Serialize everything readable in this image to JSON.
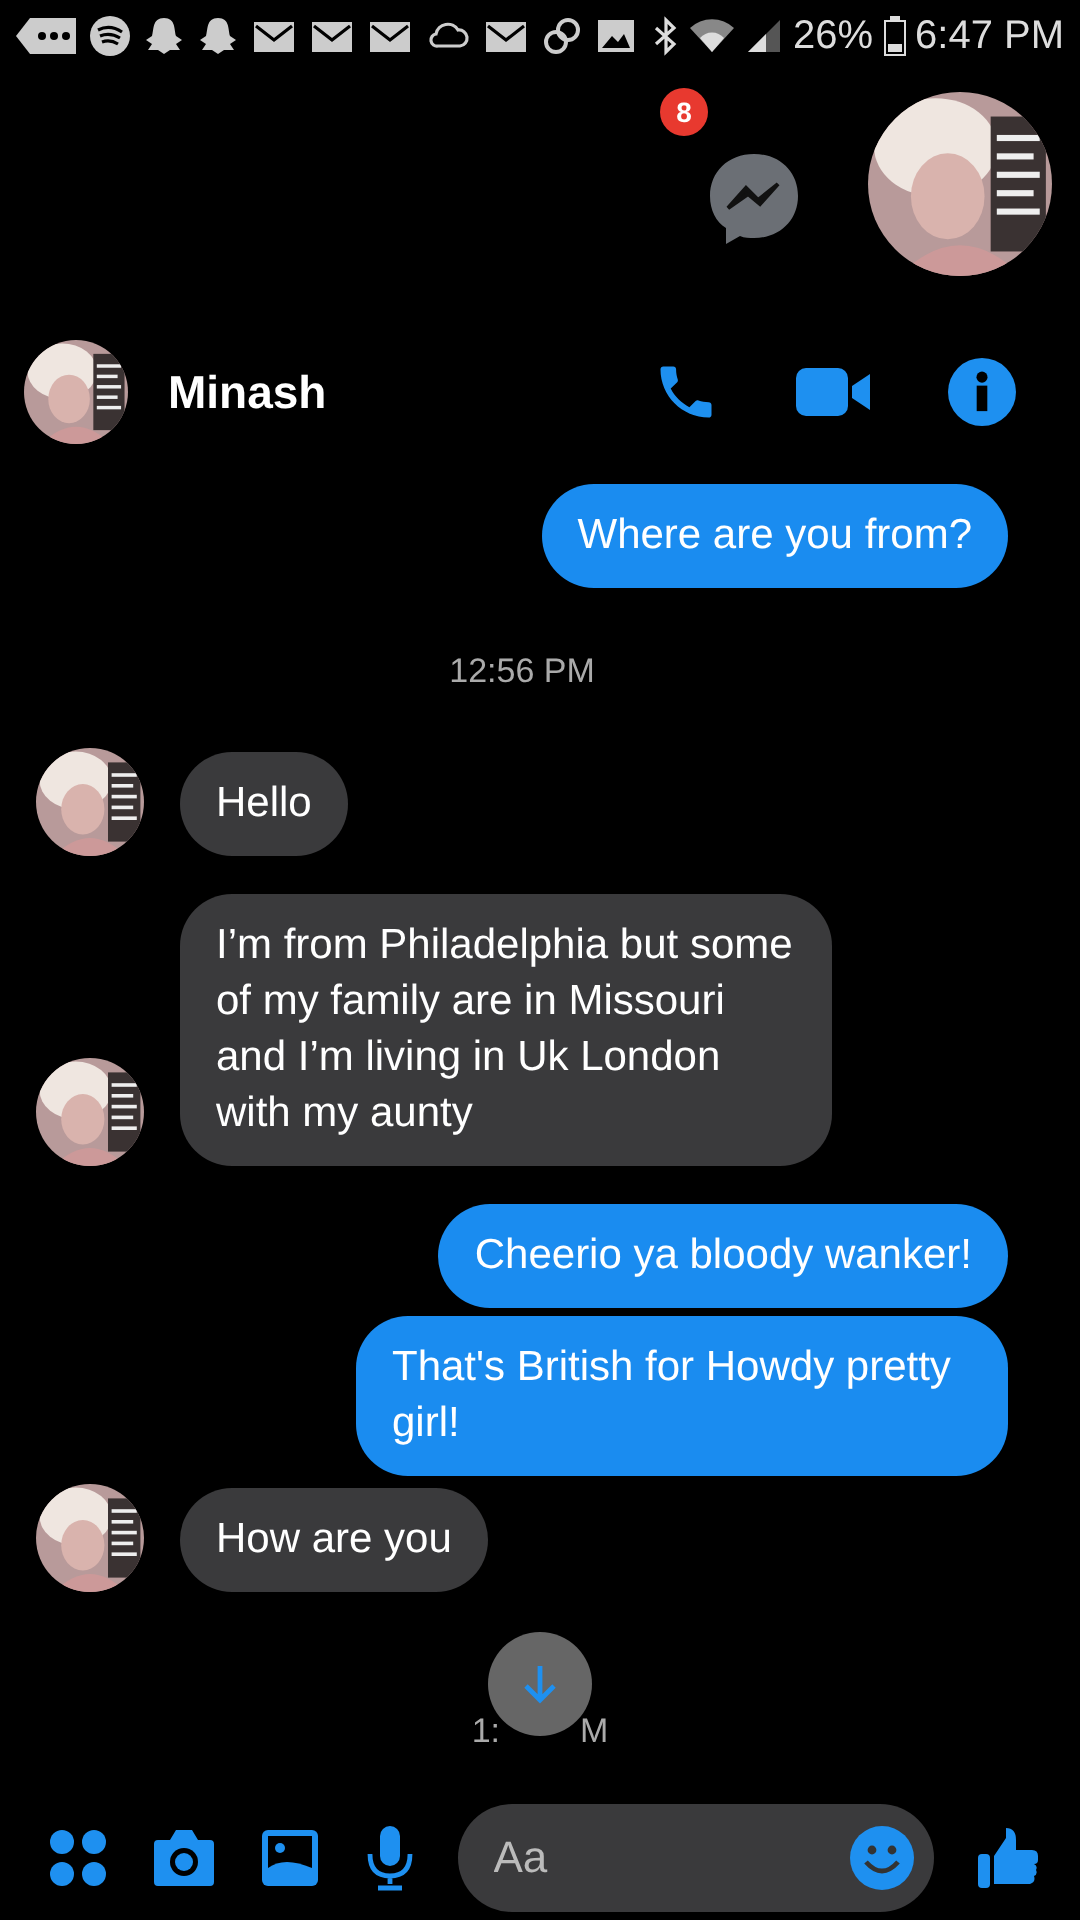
{
  "status_bar": {
    "battery": "26%",
    "time": "6:47 PM"
  },
  "chat_head": {
    "badge": "8"
  },
  "header": {
    "name": "Minash"
  },
  "messages": [
    {
      "kind": "outgoing",
      "text": "Where are you from?"
    },
    {
      "kind": "timestamp",
      "text": "12:56 PM"
    },
    {
      "kind": "incoming",
      "text": "Hello"
    },
    {
      "kind": "incoming",
      "text": "I’m from Philadelphia but some of my family are in Missouri and I’m living in Uk London with my aunty"
    },
    {
      "kind": "outgoing",
      "text": "Cheerio ya bloody wanker!"
    },
    {
      "kind": "outgoing",
      "text": "That's British for Howdy pretty girl!"
    },
    {
      "kind": "incoming",
      "text": "How are you"
    }
  ],
  "partial_timestamp": {
    "start": "1:",
    "end": "M"
  },
  "composer": {
    "placeholder": "Aa"
  }
}
